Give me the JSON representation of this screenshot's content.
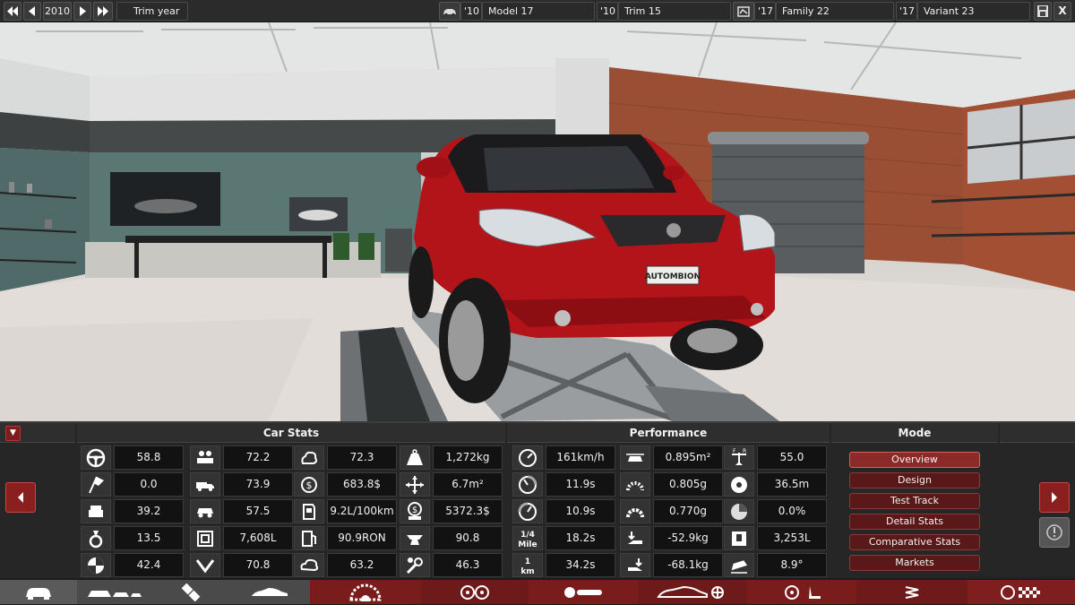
{
  "topbar": {
    "year": "2010",
    "trim_year_label": "Trim year",
    "model_year": "'10",
    "model_name": "Model 17",
    "trim_year": "'10",
    "trim_name": "Trim 15",
    "family_year": "'17",
    "family_name": "Family 22",
    "variant_year": "'17",
    "variant_name": "Variant 23",
    "close_label": "X"
  },
  "scene": {
    "plate_text": "AUTOMBION"
  },
  "panel": {
    "car_stats_title": "Car Stats",
    "performance_title": "Performance",
    "mode_title": "Mode",
    "car_stats": [
      [
        {
          "icon": "steering-wheel-icon",
          "value": "58.8"
        },
        {
          "icon": "passengers-icon",
          "value": "72.2"
        },
        {
          "icon": "engine-smoke-icon",
          "value": "72.3"
        },
        {
          "icon": "weight-icon",
          "value": "1,272kg"
        }
      ],
      [
        {
          "icon": "race-flag-icon",
          "value": "0.0"
        },
        {
          "icon": "truck-icon",
          "value": "73.9"
        },
        {
          "icon": "money-cycle-icon",
          "value": "683.8$"
        },
        {
          "icon": "dimensions-icon",
          "value": "6.7m²"
        }
      ],
      [
        {
          "icon": "seat-comfort-icon",
          "value": "39.2"
        },
        {
          "icon": "car-offroad-icon",
          "value": "57.5"
        },
        {
          "icon": "fuel-can-icon",
          "value": "9.2L/100km"
        },
        {
          "icon": "money-bag-icon",
          "value": "5372.3$"
        }
      ],
      [
        {
          "icon": "ring-prestige-icon",
          "value": "13.5"
        },
        {
          "icon": "cargo-box-icon",
          "value": "7,608L"
        },
        {
          "icon": "fuel-pump-icon",
          "value": "90.9RON"
        },
        {
          "icon": "anvil-icon",
          "value": "90.8"
        }
      ],
      [
        {
          "icon": "safety-icon",
          "value": "42.4"
        },
        {
          "icon": "down-arrow-icon",
          "value": "70.8"
        },
        {
          "icon": "emissions-cloud-icon",
          "value": "63.2"
        },
        {
          "icon": "wrench-gear-icon",
          "value": "46.3"
        }
      ]
    ],
    "performance": [
      [
        {
          "icon": "speedometer-icon",
          "value": "161km/h"
        },
        {
          "icon": "drag-area-icon",
          "value": "0.895m²"
        },
        {
          "icon": "balance-icon",
          "value": "55.0"
        }
      ],
      [
        {
          "icon": "accel-100-icon",
          "value": "11.9s"
        },
        {
          "icon": "tire-grip-icon",
          "value": "0.805g"
        },
        {
          "icon": "brake-disc-icon",
          "value": "36.5m"
        }
      ],
      [
        {
          "icon": "accel-160-icon",
          "value": "10.9s"
        },
        {
          "icon": "cornering-icon",
          "value": "0.770g"
        },
        {
          "icon": "brake-fade-icon",
          "value": "0.0%"
        }
      ],
      [
        {
          "icon": "quarter-mile-icon",
          "label": "1/4\nMile",
          "value": "18.2s"
        },
        {
          "icon": "downforce-front-icon",
          "value": "-52.9kg"
        },
        {
          "icon": "trunk-icon",
          "value": "3,253L"
        }
      ],
      [
        {
          "icon": "one-km-icon",
          "label": "1\nkm",
          "value": "34.2s"
        },
        {
          "icon": "downforce-rear-icon",
          "value": "-68.1kg"
        },
        {
          "icon": "car-tilt-icon",
          "value": "8.9°"
        }
      ]
    ],
    "modes": [
      "Overview",
      "Design",
      "Test Track",
      "Detail Stats",
      "Comparative Stats",
      "Markets"
    ],
    "active_mode": "Overview"
  },
  "colors": {
    "accent_red": "#8c2a2a",
    "panel_bg": "#262626",
    "car_red": "#b3141a"
  }
}
